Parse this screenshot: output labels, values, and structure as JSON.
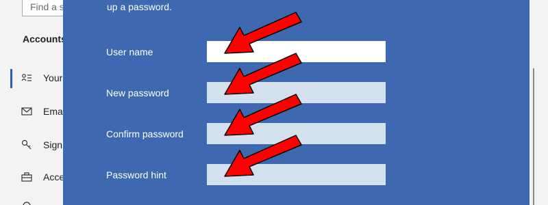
{
  "background_window": {
    "search_placeholder": "Find a s",
    "section_title": "Accounts",
    "nav_items": [
      {
        "label": "Your",
        "icon": "person-card-icon"
      },
      {
        "label": "Ema",
        "icon": "mail-icon"
      },
      {
        "label": "Sign",
        "icon": "key-icon"
      },
      {
        "label": "Acce",
        "icon": "briefcase-icon"
      }
    ]
  },
  "dialog": {
    "subtitle": "up a password.",
    "fields": [
      {
        "label": "User name",
        "value": "",
        "state": "focused"
      },
      {
        "label": "New password",
        "value": "",
        "state": "empty"
      },
      {
        "label": "Confirm password",
        "value": "",
        "state": "empty"
      },
      {
        "label": "Password hint",
        "value": "",
        "state": "empty"
      }
    ]
  },
  "annotation": {
    "arrow_color": "#ff0000",
    "arrow_outline": "#000000",
    "icon": "red-arrow-icon"
  },
  "colors": {
    "dialog_bg": "#3e68b0",
    "input_focused": "#ffffff",
    "input_empty": "#d3e0ee",
    "selection_accent": "#2b5fb5"
  }
}
